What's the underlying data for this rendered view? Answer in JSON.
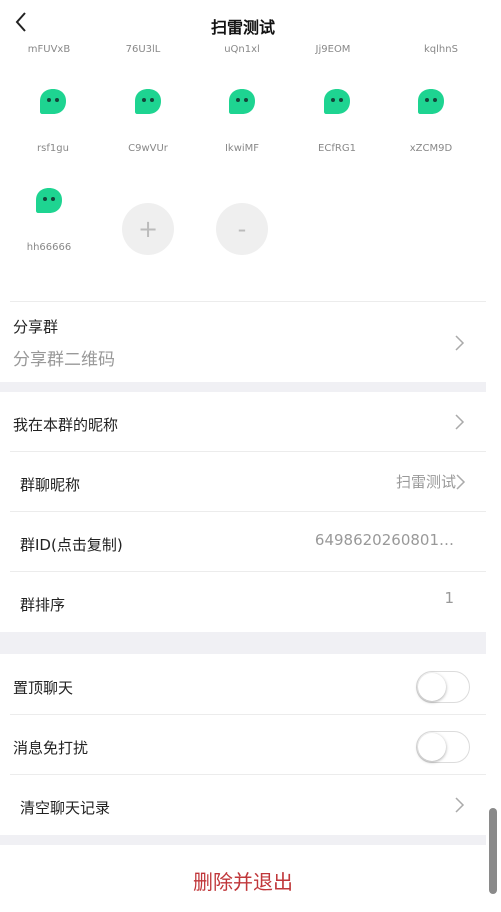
{
  "header": {
    "title": "扫雷测试"
  },
  "members_top_row": [
    "mFUVxB",
    "76U3lL",
    "uQn1xl",
    "Jj9EOM",
    "kqlhnS"
  ],
  "members": [
    "rsf1gu",
    "C9wVUr",
    "IkwiMF",
    "ECfRG1",
    "xZCM9D",
    "hh66666"
  ],
  "add_button": "+",
  "remove_button": "-",
  "share": {
    "label": "分享群",
    "value": "分享群二维码"
  },
  "settings": {
    "my_nickname_label": "我在本群的昵称",
    "group_name_label": "群聊昵称",
    "group_name_value": "扫雷测试",
    "group_id_label": "群ID(点击复制)",
    "group_id_value": "6498620260801…",
    "sort_label": "群排序",
    "sort_value": "1",
    "pin_label": "置顶聊天",
    "mute_label": "消息免打扰",
    "clear_label": "清空聊天记录"
  },
  "exit_button": "删除并退出",
  "colors": {
    "accent_green": "#1ed491",
    "danger": "#c0373a",
    "gap": "#f0f0f4"
  },
  "icons": {
    "back": "chevron-left-icon",
    "avatar": "chat-bubble-avatar-icon",
    "arrow": "chevron-right-icon"
  }
}
